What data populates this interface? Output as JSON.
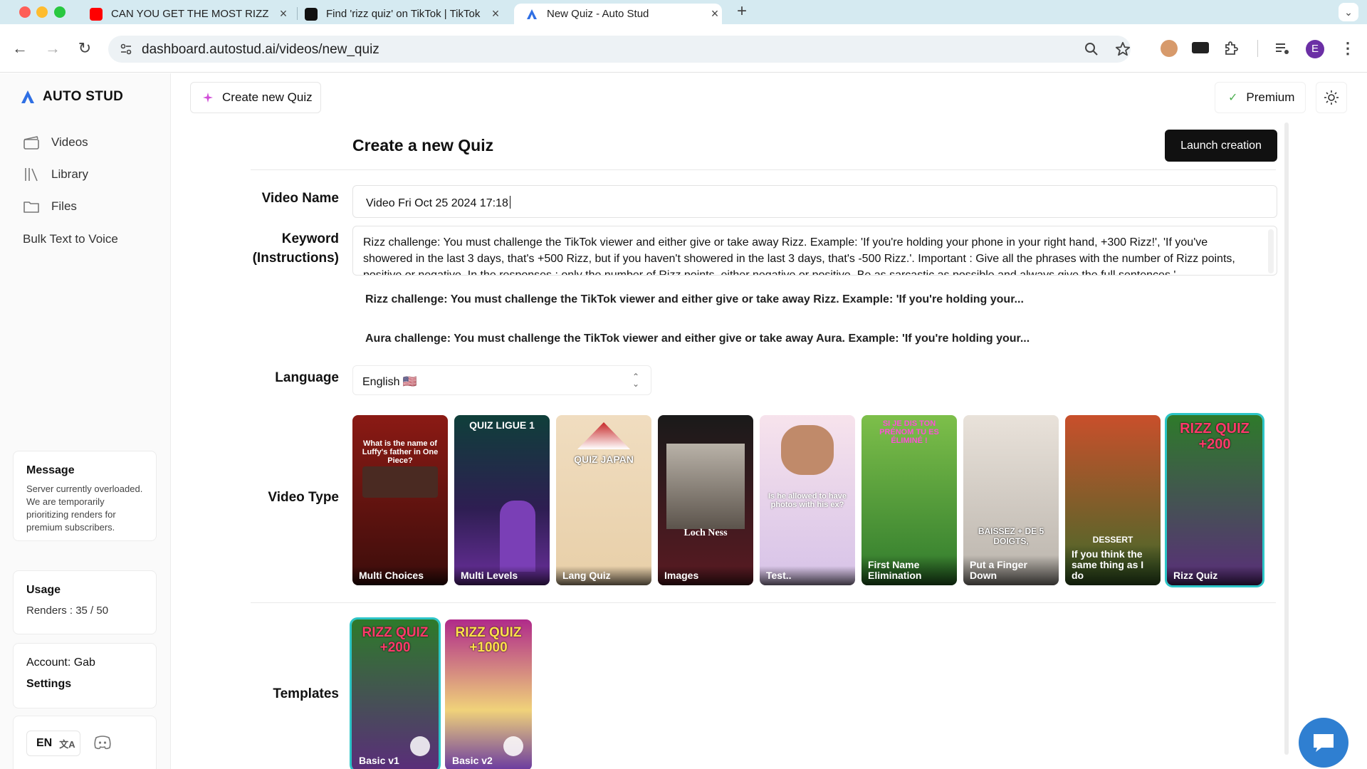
{
  "browser": {
    "tabs": [
      {
        "title": "CAN YOU GET THE MOST RIZZ",
        "favicon": "youtube-icon",
        "active": false
      },
      {
        "title": "Find 'rizz quiz' on TikTok | TikTok",
        "favicon": "tiktok-icon",
        "active": false
      },
      {
        "title": "New Quiz - Auto Stud",
        "favicon": "autostud-icon",
        "active": true
      }
    ],
    "url": "dashboard.autostud.ai/videos/new_quiz",
    "profile_initial": "E"
  },
  "sidebar": {
    "brand": "AUTO STUD",
    "items": [
      {
        "label": "Videos",
        "icon": "clapperboard-icon"
      },
      {
        "label": "Library",
        "icon": "library-icon"
      },
      {
        "label": "Files",
        "icon": "folder-icon"
      },
      {
        "label": "Bulk Text to Voice",
        "icon": ""
      }
    ],
    "message": {
      "title": "Message",
      "body": "Server currently overloaded. We are temporarily prioritizing renders for premium subscribers."
    },
    "usage": {
      "title": "Usage",
      "renders": "Renders : 35 / 50"
    },
    "account": {
      "label": "Account: Gab",
      "settings": "Settings"
    },
    "language_code": "EN"
  },
  "topbar": {
    "create_button": "Create new Quiz",
    "premium_button": "Premium"
  },
  "main": {
    "title": "Create a new Quiz",
    "launch_button": "Launch creation",
    "video_name": {
      "label": "Video Name",
      "value": "Video Fri Oct 25 2024 17:18"
    },
    "keyword": {
      "label_line1": "Keyword",
      "label_line2": "(Instructions)",
      "value": "Rizz challenge: You must challenge the TikTok viewer and either give or take away Rizz. Example: 'If you're holding your phone in your right hand, +300 Rizz!', 'If you've showered in the last 3 days, that's +500 Rizz, but if you haven't showered in the last 3 days, that's -500 Rizz.'. Important : Give all the phrases with the number of Rizz points, positive or negative. In the responses : only the number of Rizz points, either negative or positive. Be as sarcastic as possible and always give the full sentences.'",
      "suggestions": [
        "Rizz challenge: You must challenge the TikTok viewer and either give or take away Rizz. Example: 'If you're holding your...",
        "Aura challenge: You must challenge the TikTok viewer and either give or take away Aura. Example: 'If you're holding your..."
      ]
    },
    "language": {
      "label": "Language",
      "value": "English 🇺🇸"
    },
    "video_type": {
      "label": "Video Type",
      "options": [
        {
          "label": "Multi Choices",
          "top": "What is the name of Luffy's father in One Piece?",
          "selected": false
        },
        {
          "label": "Multi Levels",
          "top": "QUIZ LIGUE 1",
          "selected": false
        },
        {
          "label": "Lang Quiz",
          "top": "QUIZ JAPAN",
          "selected": false
        },
        {
          "label": "Images",
          "top": "Loch Ness",
          "selected": false
        },
        {
          "label": "Test..",
          "top": "Is he allowed to have photos with his ex?",
          "selected": false
        },
        {
          "label": "First Name Elimination",
          "top": "SI JE DIS TON PRÉNOM TU ES ÉLIMINÉ !",
          "selected": false
        },
        {
          "label": "Put a Finger Down",
          "top": "BAISSEZ + DE 5 DOIGTS,",
          "selected": false
        },
        {
          "label": "If you think the same thing as I do",
          "top": "DESSERT",
          "selected": false
        },
        {
          "label": "Rizz Quiz",
          "top": "RIZZ QUIZ +200",
          "selected": true
        }
      ]
    },
    "templates": {
      "label": "Templates",
      "options": [
        {
          "label": "Basic v1",
          "top": "RIZZ QUIZ +200",
          "selected": true
        },
        {
          "label": "Basic v2",
          "top": "RIZZ QUIZ +1000",
          "selected": false
        }
      ]
    }
  }
}
